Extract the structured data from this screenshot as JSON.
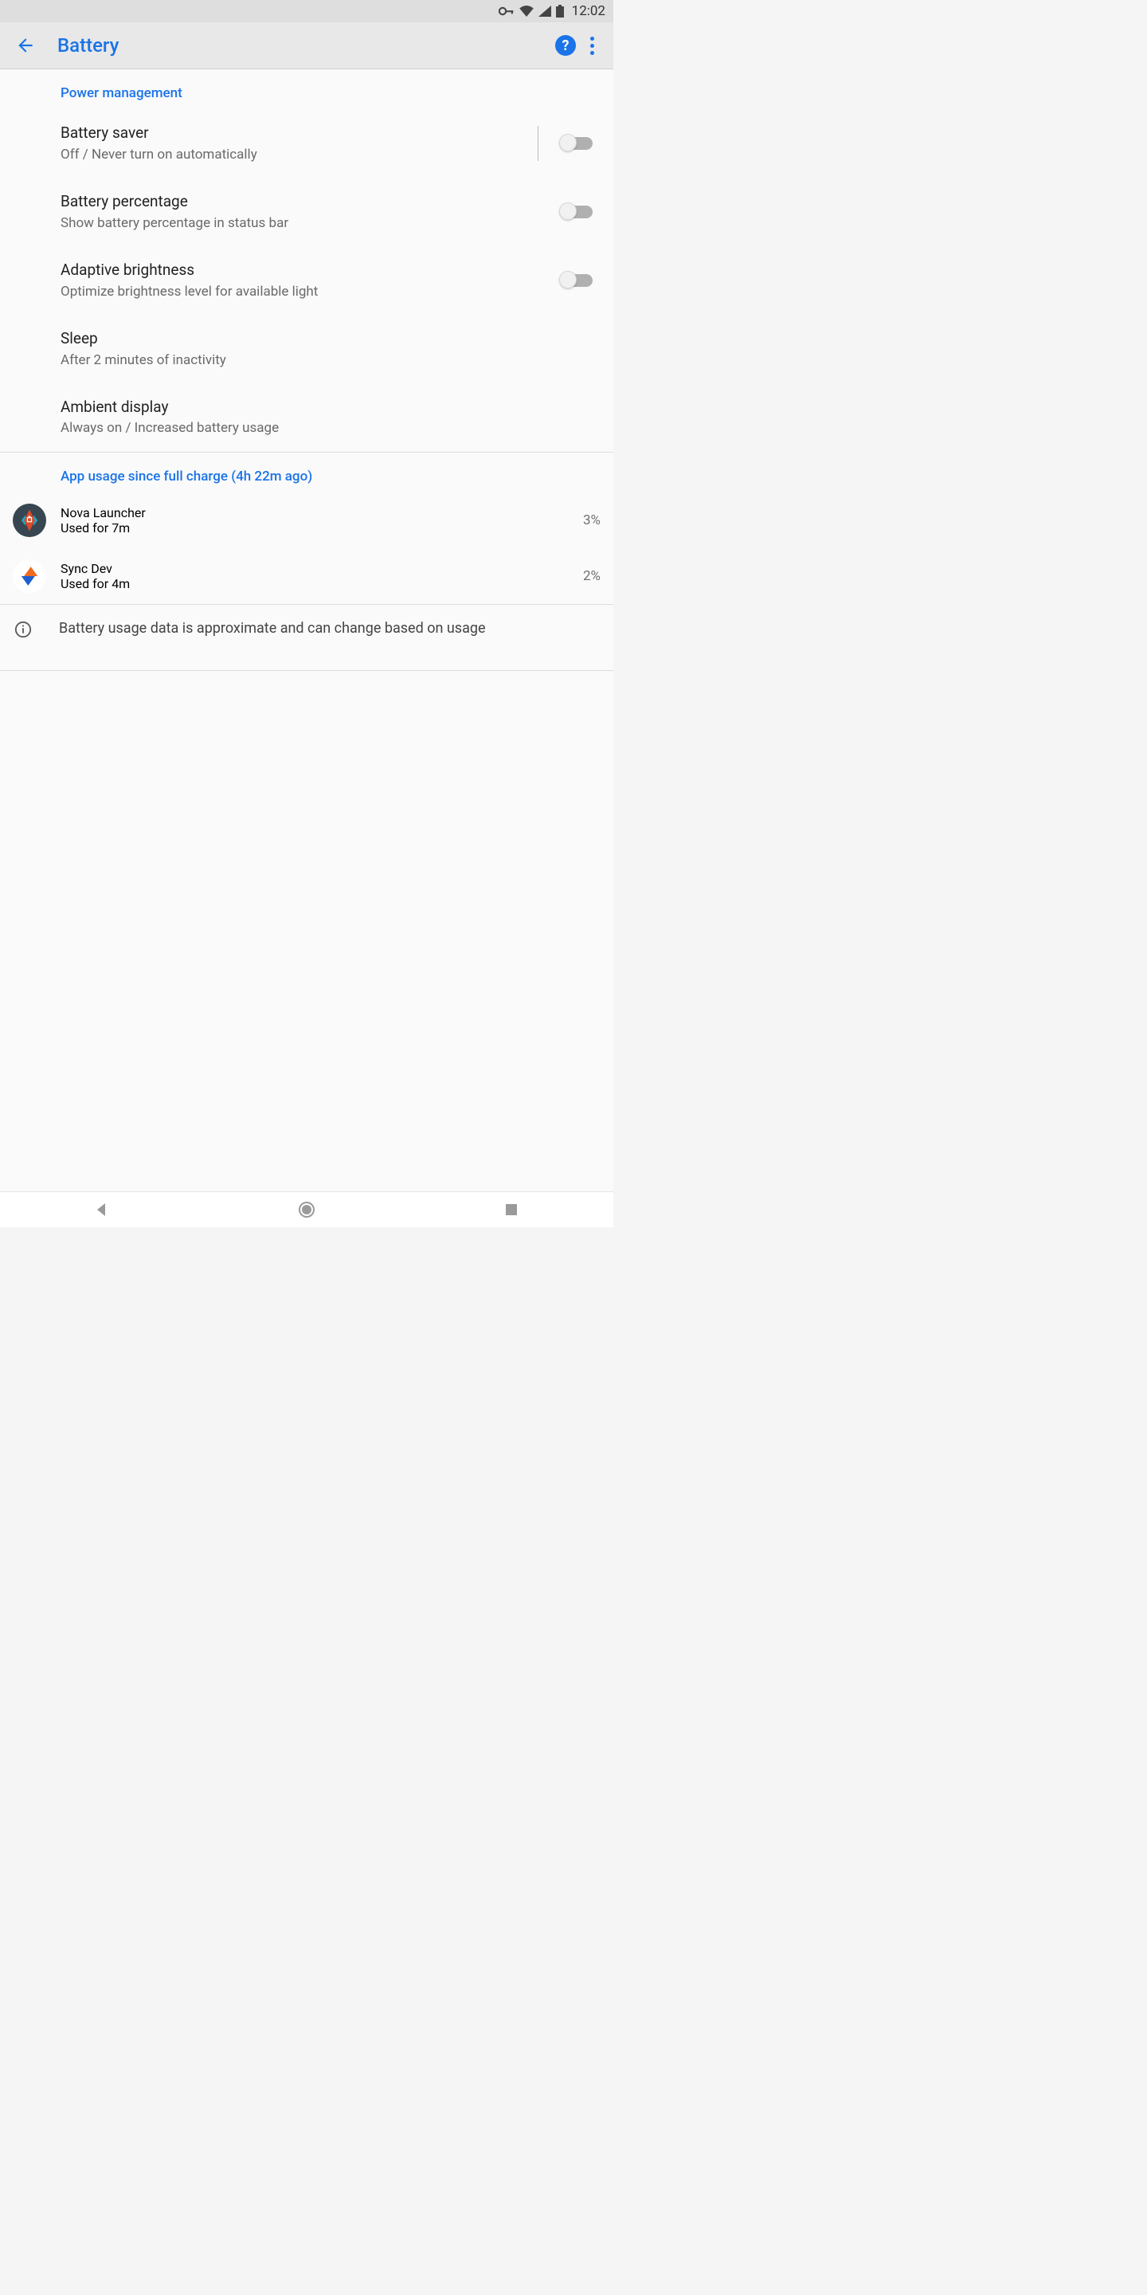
{
  "status": {
    "time": "12:02"
  },
  "app_bar": {
    "title": "Battery"
  },
  "section1": {
    "header": "Power management",
    "items": [
      {
        "title": "Battery saver",
        "sub": "Off / Never turn on automatically",
        "toggle": false,
        "vbar": true
      },
      {
        "title": "Battery percentage",
        "sub": "Show battery percentage in status bar",
        "toggle": false
      },
      {
        "title": "Adaptive brightness",
        "sub": "Optimize brightness level for available light",
        "toggle": false
      },
      {
        "title": "Sleep",
        "sub": "After 2 minutes of inactivity"
      },
      {
        "title": "Ambient display",
        "sub": "Always on / Increased battery usage"
      }
    ]
  },
  "section2": {
    "header": "App usage since full charge (4h 22m ago)",
    "apps": [
      {
        "name": "Nova Launcher",
        "sub": "Used for 7m",
        "pct": "3%"
      },
      {
        "name": "Sync Dev",
        "sub": "Used for 4m",
        "pct": "2%"
      }
    ]
  },
  "footer_note": "Battery usage data is approximate and can change based on usage"
}
